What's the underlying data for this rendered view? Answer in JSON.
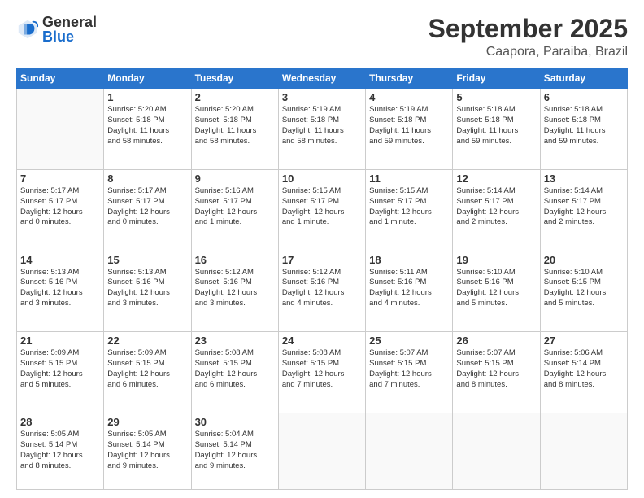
{
  "logo": {
    "general": "General",
    "blue": "Blue"
  },
  "header": {
    "title": "September 2025",
    "subtitle": "Caapora, Paraiba, Brazil"
  },
  "weekdays": [
    "Sunday",
    "Monday",
    "Tuesday",
    "Wednesday",
    "Thursday",
    "Friday",
    "Saturday"
  ],
  "weeks": [
    [
      {
        "day": "",
        "info": ""
      },
      {
        "day": "1",
        "info": "Sunrise: 5:20 AM\nSunset: 5:18 PM\nDaylight: 11 hours\nand 58 minutes."
      },
      {
        "day": "2",
        "info": "Sunrise: 5:20 AM\nSunset: 5:18 PM\nDaylight: 11 hours\nand 58 minutes."
      },
      {
        "day": "3",
        "info": "Sunrise: 5:19 AM\nSunset: 5:18 PM\nDaylight: 11 hours\nand 58 minutes."
      },
      {
        "day": "4",
        "info": "Sunrise: 5:19 AM\nSunset: 5:18 PM\nDaylight: 11 hours\nand 59 minutes."
      },
      {
        "day": "5",
        "info": "Sunrise: 5:18 AM\nSunset: 5:18 PM\nDaylight: 11 hours\nand 59 minutes."
      },
      {
        "day": "6",
        "info": "Sunrise: 5:18 AM\nSunset: 5:18 PM\nDaylight: 11 hours\nand 59 minutes."
      }
    ],
    [
      {
        "day": "7",
        "info": "Sunrise: 5:17 AM\nSunset: 5:17 PM\nDaylight: 12 hours\nand 0 minutes."
      },
      {
        "day": "8",
        "info": "Sunrise: 5:17 AM\nSunset: 5:17 PM\nDaylight: 12 hours\nand 0 minutes."
      },
      {
        "day": "9",
        "info": "Sunrise: 5:16 AM\nSunset: 5:17 PM\nDaylight: 12 hours\nand 1 minute."
      },
      {
        "day": "10",
        "info": "Sunrise: 5:15 AM\nSunset: 5:17 PM\nDaylight: 12 hours\nand 1 minute."
      },
      {
        "day": "11",
        "info": "Sunrise: 5:15 AM\nSunset: 5:17 PM\nDaylight: 12 hours\nand 1 minute."
      },
      {
        "day": "12",
        "info": "Sunrise: 5:14 AM\nSunset: 5:17 PM\nDaylight: 12 hours\nand 2 minutes."
      },
      {
        "day": "13",
        "info": "Sunrise: 5:14 AM\nSunset: 5:17 PM\nDaylight: 12 hours\nand 2 minutes."
      }
    ],
    [
      {
        "day": "14",
        "info": "Sunrise: 5:13 AM\nSunset: 5:16 PM\nDaylight: 12 hours\nand 3 minutes."
      },
      {
        "day": "15",
        "info": "Sunrise: 5:13 AM\nSunset: 5:16 PM\nDaylight: 12 hours\nand 3 minutes."
      },
      {
        "day": "16",
        "info": "Sunrise: 5:12 AM\nSunset: 5:16 PM\nDaylight: 12 hours\nand 3 minutes."
      },
      {
        "day": "17",
        "info": "Sunrise: 5:12 AM\nSunset: 5:16 PM\nDaylight: 12 hours\nand 4 minutes."
      },
      {
        "day": "18",
        "info": "Sunrise: 5:11 AM\nSunset: 5:16 PM\nDaylight: 12 hours\nand 4 minutes."
      },
      {
        "day": "19",
        "info": "Sunrise: 5:10 AM\nSunset: 5:16 PM\nDaylight: 12 hours\nand 5 minutes."
      },
      {
        "day": "20",
        "info": "Sunrise: 5:10 AM\nSunset: 5:15 PM\nDaylight: 12 hours\nand 5 minutes."
      }
    ],
    [
      {
        "day": "21",
        "info": "Sunrise: 5:09 AM\nSunset: 5:15 PM\nDaylight: 12 hours\nand 5 minutes."
      },
      {
        "day": "22",
        "info": "Sunrise: 5:09 AM\nSunset: 5:15 PM\nDaylight: 12 hours\nand 6 minutes."
      },
      {
        "day": "23",
        "info": "Sunrise: 5:08 AM\nSunset: 5:15 PM\nDaylight: 12 hours\nand 6 minutes."
      },
      {
        "day": "24",
        "info": "Sunrise: 5:08 AM\nSunset: 5:15 PM\nDaylight: 12 hours\nand 7 minutes."
      },
      {
        "day": "25",
        "info": "Sunrise: 5:07 AM\nSunset: 5:15 PM\nDaylight: 12 hours\nand 7 minutes."
      },
      {
        "day": "26",
        "info": "Sunrise: 5:07 AM\nSunset: 5:15 PM\nDaylight: 12 hours\nand 8 minutes."
      },
      {
        "day": "27",
        "info": "Sunrise: 5:06 AM\nSunset: 5:14 PM\nDaylight: 12 hours\nand 8 minutes."
      }
    ],
    [
      {
        "day": "28",
        "info": "Sunrise: 5:05 AM\nSunset: 5:14 PM\nDaylight: 12 hours\nand 8 minutes."
      },
      {
        "day": "29",
        "info": "Sunrise: 5:05 AM\nSunset: 5:14 PM\nDaylight: 12 hours\nand 9 minutes."
      },
      {
        "day": "30",
        "info": "Sunrise: 5:04 AM\nSunset: 5:14 PM\nDaylight: 12 hours\nand 9 minutes."
      },
      {
        "day": "",
        "info": ""
      },
      {
        "day": "",
        "info": ""
      },
      {
        "day": "",
        "info": ""
      },
      {
        "day": "",
        "info": ""
      }
    ]
  ]
}
